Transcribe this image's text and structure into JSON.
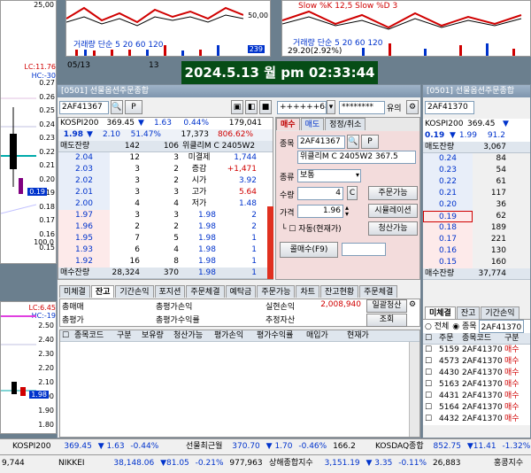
{
  "datetime_overlay": "2024.5.13 월 pm 02:33:44",
  "bg_left_chart": {
    "ticks_top": [
      "25,00"
    ],
    "ticks": [
      "0.27",
      "0.26",
      "0.25",
      "0.24",
      "0.23",
      "0.22",
      "0.21",
      "0.20",
      "0.19",
      "0.18",
      "0.17",
      "0.16",
      "0.15"
    ],
    "lc": "LC:11.76",
    "hc": "HC:-30",
    "pct": "100.0",
    "lc2": "LC:6.45",
    "hc2": "HC:-19",
    "ticks2": [
      "2.50",
      "2.40",
      "2.30",
      "2.20",
      "2.10",
      "2.00",
      "1.90",
      "1.80"
    ],
    "price_badge": "0.19",
    "price_badge2": "1.98"
  },
  "top_charts": {
    "chart1": {
      "legend": "거래량 단순 5 20 60 120",
      "ticks": [
        "50,00",
        "239"
      ],
      "date": "05/13",
      "num": "13"
    },
    "chart2": {
      "legend": "Slow %K 12,5  Slow %D 3",
      "legend2": "거래량 단순 5 20 60 120",
      "pct": "29.20(2.92%)"
    }
  },
  "order_window": {
    "title": "[0501] 선물옵션주문종합",
    "code": "2AF41367",
    "acct_mask": "++++++68",
    "acct_mask2": "********",
    "acct_suffix": "유의",
    "index_row": {
      "name": "KOSPI200",
      "value": "369.45",
      "arrow": "▼",
      "change": "1.63",
      "rate": "0.44%",
      "volume": "179,041"
    },
    "price_row": {
      "price": "1.98",
      "arrow": "▼",
      "change": "2.10",
      "rate": "51.47%",
      "vol": "17,373",
      "vol_rate": "806.62%"
    },
    "book_header": {
      "ask_qty": "매도잔량",
      "c2": "142",
      "c3": "106",
      "name": "위클리M C 2405W2"
    },
    "book_rows": [
      {
        "ask_qty": "2.04",
        "n1": "12",
        "n2": "3",
        "label": "미결제",
        "val": "1,744",
        "type": "ask"
      },
      {
        "ask_qty": "2.03",
        "n1": "3",
        "n2": "2",
        "label": "증감",
        "val": "+1,471",
        "type": "ask"
      },
      {
        "ask_qty": "2.02",
        "n1": "3",
        "n2": "2",
        "label": "시가",
        "val": "3.92",
        "type": "ask"
      },
      {
        "ask_qty": "2.01",
        "n1": "3",
        "n2": "3",
        "label": "고가",
        "val": "5.64",
        "type": "ask"
      },
      {
        "ask_qty": "2.00",
        "n1": "4",
        "n2": "4",
        "label": "저가",
        "val": "1.48",
        "type": "ask"
      },
      {
        "ask_qty": "1.97",
        "n1": "3",
        "n2": "3",
        "label": "1.98",
        "val": "2",
        "type": "bid"
      },
      {
        "ask_qty": "1.96",
        "n1": "2",
        "n2": "2",
        "label": "1.98",
        "val": "2",
        "type": "bid"
      },
      {
        "ask_qty": "1.95",
        "n1": "7",
        "n2": "5",
        "label": "1.98",
        "val": "1",
        "type": "bid"
      },
      {
        "ask_qty": "1.93",
        "n1": "6",
        "n2": "4",
        "label": "1.98",
        "val": "1",
        "type": "bid"
      },
      {
        "ask_qty": "1.92",
        "n1": "16",
        "n2": "8",
        "label": "1.98",
        "val": "1",
        "type": "bid"
      }
    ],
    "book_footer": {
      "label": "매수잔량",
      "qty": "28,324",
      "c3": "370",
      "price": "1.98",
      "val": "1"
    },
    "order_tabs": [
      "매수",
      "매도",
      "정정/취소"
    ],
    "form": {
      "code_label": "종목",
      "code": "2AF41367",
      "name": "위클리M C 2405W2 367.5",
      "type_label": "종류",
      "type": "보통",
      "qty_label": "수량",
      "qty": "4",
      "qty_btn": "C",
      "price_label": "가격",
      "price": "1.96",
      "auto_label": "자동(현재가)",
      "btn_orderable": "주문가능",
      "btn_sim": "시뮬레이션",
      "btn_liq": "청산가능",
      "btn_buy": "콜매수(F9)"
    },
    "bottom_tabs": [
      "미체결",
      "잔고",
      "기간손익",
      "포지션",
      "주문체결",
      "예탁금",
      "주문가능",
      "차트",
      "잔고현황",
      "주문체결"
    ],
    "summary": {
      "l1": "총매매",
      "l2": "총평가",
      "l3": "총평가손익",
      "l4": "총평가수익률",
      "l5": "실현손익",
      "v5": "2,008,940",
      "l6": "추정자산",
      "btn1": "일괄청산",
      "btn2": "조회"
    },
    "grid_headers": [
      "종목코드",
      "구분",
      "보유량",
      "청산가능",
      "평가손익",
      "평가수익률",
      "매입가",
      "현재가"
    ]
  },
  "right_window": {
    "title": "[0501] 선물옵션주문종합",
    "code": "2AF41370",
    "index_row": {
      "name": "KOSPI200",
      "value": "369.45",
      "arrow": "▼"
    },
    "price_row": {
      "price": "0.19",
      "arrow": "▼",
      "change": "1.99",
      "rate": "91.2"
    },
    "book_header": {
      "label": "매도잔량",
      "qty": "3,067"
    },
    "book_rows": [
      {
        "p": "0.24",
        "q": "84"
      },
      {
        "p": "0.23",
        "q": "54"
      },
      {
        "p": "0.22",
        "q": "61"
      },
      {
        "p": "0.21",
        "q": "117"
      },
      {
        "p": "0.20",
        "q": "36"
      },
      {
        "p": "0.19",
        "q": "62"
      },
      {
        "p": "0.18",
        "q": "189"
      },
      {
        "p": "0.17",
        "q": "221"
      },
      {
        "p": "0.16",
        "q": "130"
      },
      {
        "p": "0.15",
        "q": "160"
      }
    ],
    "book_footer": {
      "label": "매수잔량",
      "qty": "37,774"
    },
    "tabs": [
      "미체결",
      "잔고",
      "기간손익"
    ],
    "radio": {
      "all": "전체",
      "stock": "종목",
      "code": "2AF41370"
    },
    "grid_headers": [
      "주문",
      "종목코드",
      "구분"
    ],
    "orders": [
      {
        "no": "5159",
        "code": "2AF41370",
        "side": "매수"
      },
      {
        "no": "4573",
        "code": "2AF41370",
        "side": "매수"
      },
      {
        "no": "4430",
        "code": "2AF41370",
        "side": "매수"
      },
      {
        "no": "5163",
        "code": "2AF41370",
        "side": "매수"
      },
      {
        "no": "4431",
        "code": "2AF41370",
        "side": "매수"
      },
      {
        "no": "5164",
        "code": "2AF41370",
        "side": "매수"
      },
      {
        "no": "4432",
        "code": "2AF41370",
        "side": "매수"
      }
    ]
  },
  "ticker": {
    "row1": [
      {
        "name": "KOSPI200",
        "val": "369.45",
        "chg": "▼ 1.63",
        "rate": "-0.44%"
      },
      {
        "name": "선물최근월",
        "val": "370.70",
        "chg": "▼ 1.70",
        "rate": "-0.46%",
        "extra": "166.2"
      },
      {
        "name": "KOSDAQ종합",
        "val": "852.75",
        "chg": "▼11.41",
        "rate": "-1.32%"
      }
    ],
    "row2": [
      {
        "name": "9,744"
      },
      {
        "name": "NIKKEI",
        "val": "38,148.06",
        "chg": "▼81.05",
        "rate": "-0.21%",
        "extra": "977,963"
      },
      {
        "name": "상해종합지수",
        "val": "3,151.19",
        "chg": "▼ 3.35",
        "rate": "-0.11%",
        "extra": "26,883"
      },
      {
        "name": "홍콩지수"
      }
    ]
  }
}
